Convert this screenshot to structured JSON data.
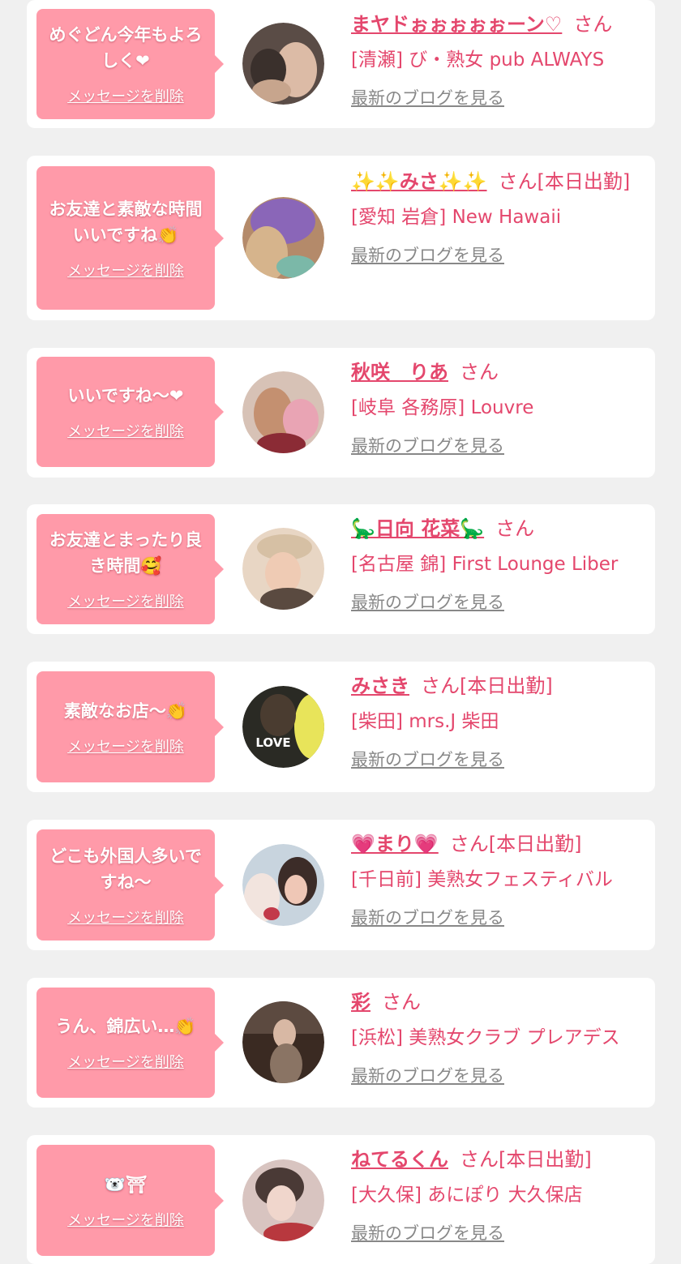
{
  "colors": {
    "accent": "#e4476d",
    "bubble": "#ff9aa9",
    "card": "#ffffff",
    "background": "#f0f0f0",
    "blog_link": "#888888"
  },
  "common": {
    "delete_label": "メッセージを削除",
    "blog_label": "最新のブログを見る"
  },
  "entries": [
    {
      "message": "めぐどん今年もよろしく❤",
      "name": "まヤドぉぉぉぉぉーン♡",
      "suffix": "さん",
      "shop": "[清瀬] び・熟女 pub ALWAYS",
      "avatar_colors": [
        "#6b5a52",
        "#d9b9a4"
      ]
    },
    {
      "message": "お友達と素敵な時間いいですね👏",
      "name": "✨✨みさ✨✨",
      "suffix": "さん[本日出勤]",
      "shop": "[愛知 岩倉] New Hawaii",
      "avatar_colors": [
        "#8a66b8",
        "#c49a78"
      ]
    },
    {
      "message": "いいですね〜❤",
      "name": "秋咲　りあ",
      "suffix": "さん",
      "shop": "[岐阜 各務原] Louvre",
      "avatar_colors": [
        "#e9a4b4",
        "#8b2b35"
      ]
    },
    {
      "message": "お友達とまったり良き時間🥰",
      "name": "🦕日向 花菜🦕",
      "suffix": "さん",
      "shop": "[名古屋 錦] First Lounge Liber",
      "avatar_colors": [
        "#e8d6c4",
        "#5a4a40"
      ]
    },
    {
      "message": "素敵なお店〜👏",
      "name": "みさき",
      "suffix": "さん[本日出勤]",
      "shop": "[柴田] mrs.J 柴田",
      "avatar_colors": [
        "#2a2a24",
        "#e8e45a"
      ],
      "avatar_text": "LOVE"
    },
    {
      "message": "どこも外国人多いですね〜",
      "name": "💗まり💗",
      "suffix": "さん[本日出勤]",
      "shop": "[千日前] 美熟女フェスティバル",
      "avatar_colors": [
        "#b8c8d8",
        "#c23a4a"
      ]
    },
    {
      "message": "うん、錦広い…👏",
      "name": "彩",
      "suffix": "さん",
      "shop": "[浜松] 美熟女クラブ プレアデス",
      "avatar_colors": [
        "#3a2a22",
        "#8a7464"
      ]
    },
    {
      "message": "🐻‍❄️⛩",
      "name": "ねてるくん",
      "suffix": "さん[本日出勤]",
      "shop": "[大久保] あにぽり 大久保店",
      "avatar_colors": [
        "#d8c4c0",
        "#4a3a36"
      ]
    }
  ]
}
